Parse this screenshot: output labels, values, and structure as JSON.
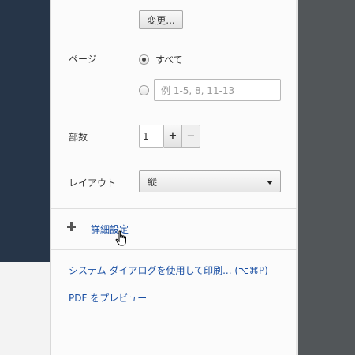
{
  "destination": {
    "change_button_label": "変更..."
  },
  "pages": {
    "label": "ページ",
    "all_option_label": "すべて",
    "all_selected": true,
    "range_placeholder": "例 1-5, 8, 11-13",
    "range_value": ""
  },
  "copies": {
    "label": "部数",
    "value": "1",
    "increment_label": "+",
    "decrement_label": "−"
  },
  "layout": {
    "label": "レイアウト",
    "selected": "縦"
  },
  "advanced": {
    "expand_icon": "plus-icon",
    "label": "詳細設定"
  },
  "links": {
    "system_dialog": "システム ダイアログを使用して印刷... (⌥⌘P)",
    "preview_pdf": "PDF をプレビュー"
  },
  "colors": {
    "link": "#1a4fa3",
    "sidebar_dark": "#263548",
    "preview_dark": "#525659",
    "panel_bg": "#fbfbfb"
  }
}
